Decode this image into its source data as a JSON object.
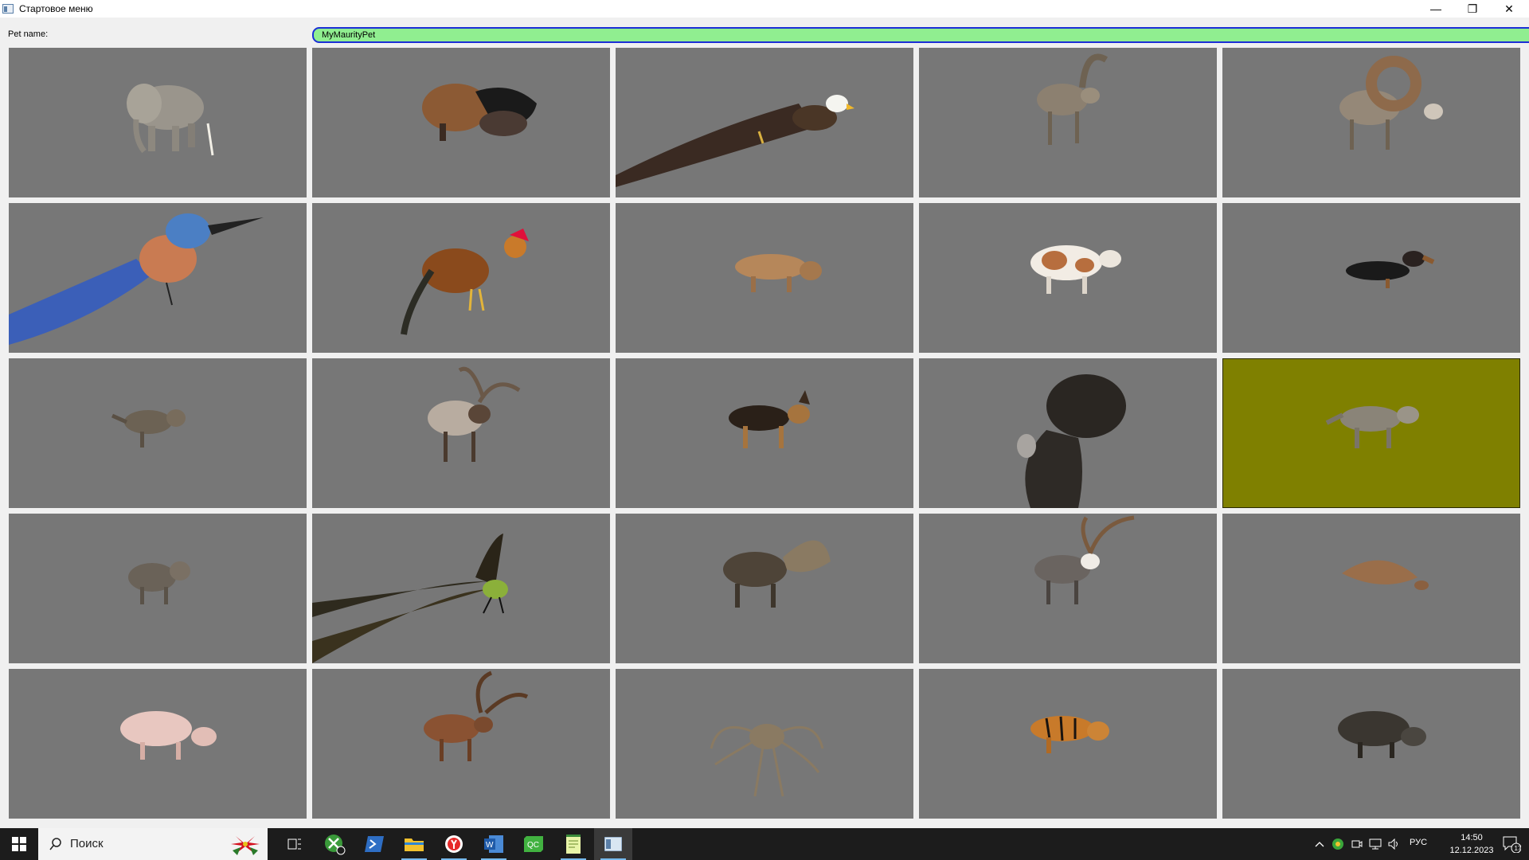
{
  "window": {
    "title": "Стартовое меню",
    "minimize_glyph": "—",
    "maximize_glyph": "❐",
    "close_glyph": "✕"
  },
  "form": {
    "pet_name_label": "Pet name:",
    "pet_name_value": "MyMaurityPet",
    "input_color": "#90ee90",
    "input_border_color": "#1b2fd6"
  },
  "grid": {
    "tile_background": "#777777",
    "selected_background": "#7f8000",
    "selected_index": 14,
    "animals": [
      "elephant",
      "bison",
      "eagle",
      "ibex",
      "bighorn-sheep",
      "bluebird",
      "rooster",
      "cougar",
      "cow",
      "dachshund",
      "wildcat",
      "elk",
      "german-shepherd",
      "gorilla",
      "wolf",
      "wolf-pup",
      "dragonfly",
      "moose",
      "deer-buck",
      "pangolin",
      "pig",
      "red-deer",
      "spider",
      "tiger",
      "boar"
    ]
  },
  "taskbar": {
    "search_placeholder": "Поиск",
    "tray_language": "РУС",
    "clock_time": "14:50",
    "clock_date": "12.12.2023",
    "notification_count": "17",
    "apps": [
      "task-view",
      "xbox",
      "powershell",
      "file-explorer",
      "yandex-browser",
      "word",
      "qt-creator",
      "notepad",
      "pet-app"
    ]
  }
}
